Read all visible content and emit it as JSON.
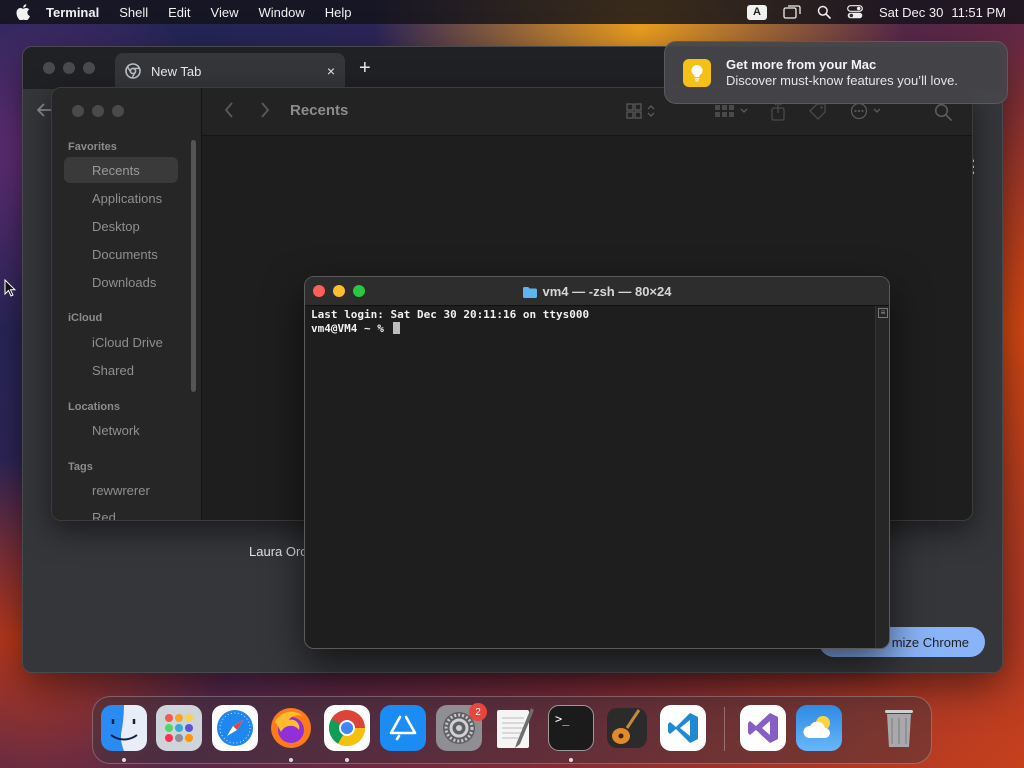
{
  "menubar": {
    "app_name": "Terminal",
    "menus": [
      "Shell",
      "Edit",
      "View",
      "Window",
      "Help"
    ],
    "input_source": "A",
    "date": "Sat Dec 30",
    "time": "11:51 PM"
  },
  "chrome": {
    "tab_title": "New Tab",
    "tab_close": "×",
    "new_tab": "+",
    "shortcut_label": "Laura Orc",
    "customize_button": "mize Chrome"
  },
  "finder": {
    "title": "Recents",
    "sections": {
      "favorites": "Favorites",
      "icloud": "iCloud",
      "locations": "Locations",
      "tags": "Tags"
    },
    "favorites": [
      "Recents",
      "Applications",
      "Desktop",
      "Documents",
      "Downloads"
    ],
    "icloud_items": [
      "iCloud Drive",
      "Shared"
    ],
    "locations_items": [
      "Network"
    ],
    "tags_items": [
      "rewwrerer",
      "Red"
    ]
  },
  "terminal": {
    "title": "vm4 — -zsh — 80×24",
    "lines": [
      "Last login: Sat Dec 30 20:11:16 on ttys000",
      "vm4@VM4 ~ % "
    ]
  },
  "notification": {
    "title": "Get more from your Mac",
    "body": "Discover must-know features you’ll love."
  },
  "dock": {
    "apps": [
      "finder-icon",
      "launchpad-icon",
      "safari-icon",
      "firefox-icon",
      "chrome-icon",
      "app-store-icon",
      "system-settings-icon",
      "textedit-icon",
      "terminal-icon",
      "garageband-icon",
      "vscode-icon",
      "visual-studio-icon",
      "weather-icon",
      "trash-icon"
    ],
    "settings_badge": "2",
    "terminal_prompt": ">_"
  },
  "colors": {
    "traffic_red": "#fe5f57",
    "traffic_yellow": "#febc2e",
    "traffic_green": "#28c840",
    "chrome_accent": "#8ab4f8"
  }
}
